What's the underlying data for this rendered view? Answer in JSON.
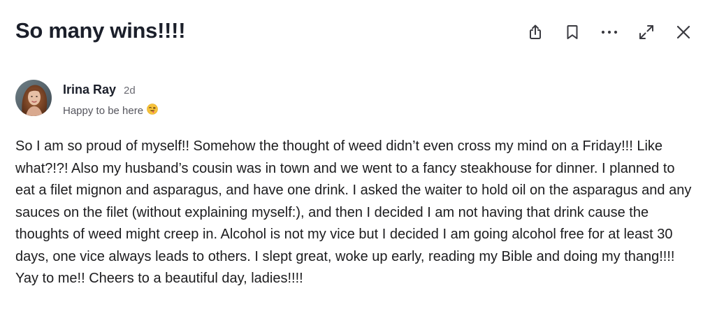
{
  "post": {
    "title": "So many wins!!!!",
    "body": "So I am so proud of myself!! Somehow the thought of weed didn’t even cross my mind on a Friday!!! Like what?!?! Also my husband’s cousin was in town and we went to a fancy steakhouse for dinner. I planned to eat a filet mignon and asparagus, and have one drink. I asked the waiter to hold oil on the asparagus and any sauces on the filet (without explaining myself:), and then I decided I am not having that drink cause the thoughts of weed might creep in. Alcohol is not my vice but I decided I am going alcohol free for at least 30 days, one vice always leads to others. I slept great, woke up early, reading my Bible and doing my thang!!!! Yay to me!! Cheers to a beautiful day, ladies!!!!"
  },
  "author": {
    "name": "Irina Ray",
    "age": "2d",
    "status": "Happy to be here",
    "status_emoji": "winking-face-with-tongue-icon"
  },
  "toolbar": {
    "icons": [
      "share-icon",
      "bookmark-icon",
      "more-icon",
      "expand-icon",
      "close-icon"
    ]
  },
  "colors": {
    "text": "#1c1c1e",
    "title": "#1b1f2a",
    "muted": "#6b6b73",
    "icon": "#3a3a40"
  }
}
